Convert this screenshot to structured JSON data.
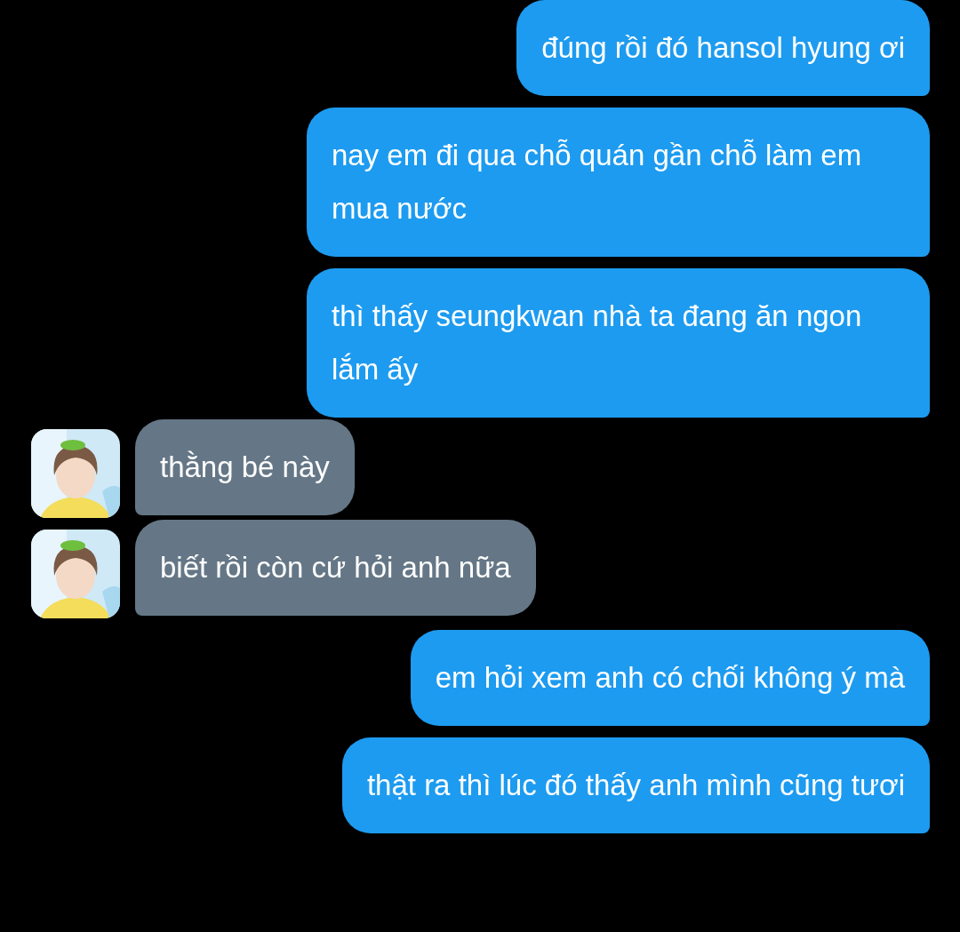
{
  "messages": [
    {
      "kind": "outgoing",
      "text": "đúng rồi đó hansol hyung ơi"
    },
    {
      "kind": "outgoing",
      "text": "nay em đi qua chỗ quán gần chỗ làm em mua nước"
    },
    {
      "kind": "outgoing",
      "text": "thì thấy seungkwan nhà ta đang ăn ngon lắm ấy"
    },
    {
      "kind": "incoming",
      "text": "thằng bé này"
    },
    {
      "kind": "incoming",
      "text": "biết rồi còn cứ hỏi anh nữa"
    },
    {
      "kind": "outgoing",
      "text": "em hỏi xem anh có chối không ý mà"
    },
    {
      "kind": "outgoing",
      "text": "thật ra thì lúc đó thấy anh mình cũng tươi"
    }
  ]
}
